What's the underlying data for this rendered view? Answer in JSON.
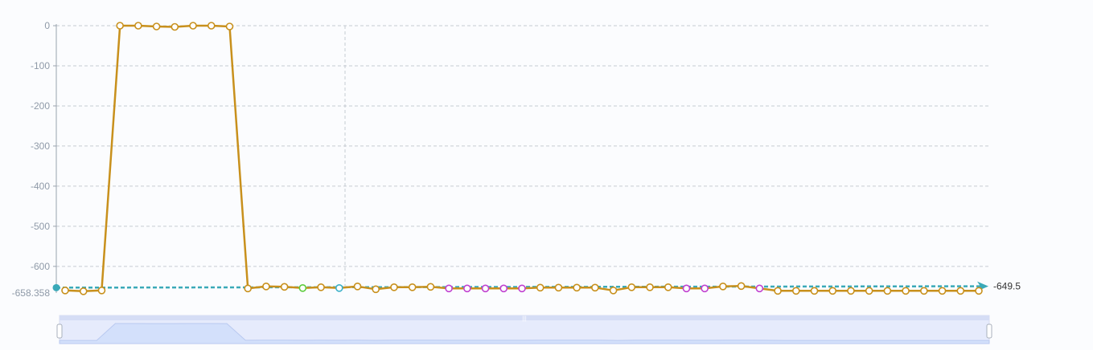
{
  "chart_data": {
    "type": "line",
    "title": "",
    "xlabel": "",
    "ylabel": "",
    "ylim": [
      -658.358,
      0
    ],
    "yticks": [
      0,
      -100,
      -200,
      -300,
      -400,
      -500,
      -600
    ],
    "ymin_label": "-658.358",
    "grid": true,
    "series": [
      {
        "values": [
          -660,
          -662,
          -660,
          0,
          0,
          -2,
          -3,
          0,
          0,
          -2,
          -655,
          -650,
          -651,
          -654,
          -652,
          -654,
          -650,
          -657,
          -652,
          -652,
          -651,
          -655,
          -655,
          -655,
          -655,
          -655,
          -653,
          -653,
          -653,
          -653,
          -660,
          -652,
          -652,
          -652,
          -655,
          -655,
          -650,
          -649,
          -655,
          -661,
          -661,
          -661,
          -661,
          -661,
          -661,
          -661,
          -661,
          -661,
          -661,
          -661,
          -661
        ],
        "marker_colors": [
          "#c8901c",
          "#c8901c",
          "#c8901c",
          "#c8901c",
          "#c8901c",
          "#c8901c",
          "#c8901c",
          "#c8901c",
          "#c8901c",
          "#c8901c",
          "#c8901c",
          "#c8901c",
          "#c8901c",
          "#5ccc3c",
          "#c8901c",
          "#3ab0c8",
          "#c8901c",
          "#c8901c",
          "#c8901c",
          "#c8901c",
          "#c8901c",
          "#c040d0",
          "#c040d0",
          "#c040d0",
          "#c040d0",
          "#c040d0",
          "#c8901c",
          "#c8901c",
          "#c8901c",
          "#c8901c",
          "#c8901c",
          "#c8901c",
          "#c8901c",
          "#c8901c",
          "#c040d0",
          "#c040d0",
          "#c8901c",
          "#c8901c",
          "#c040d0",
          "#c8901c",
          "#c8901c",
          "#c8901c",
          "#c8901c",
          "#c8901c",
          "#c8901c",
          "#c8901c",
          "#c8901c",
          "#c8901c",
          "#c8901c",
          "#c8901c",
          "#c8901c"
        ]
      }
    ],
    "trendline": {
      "start": -653,
      "end": -649.5,
      "end_label": "-649.5"
    },
    "colors": {
      "line": "#c8901c",
      "trend": "#3aa9b8",
      "grid": "#c6cbd2",
      "axis": "#9aa3ad",
      "zoom_fill": "#d3e0fb",
      "zoom_bg": "#e6ebfc"
    },
    "zoom_slider": {
      "start": 0,
      "end": 1
    }
  }
}
